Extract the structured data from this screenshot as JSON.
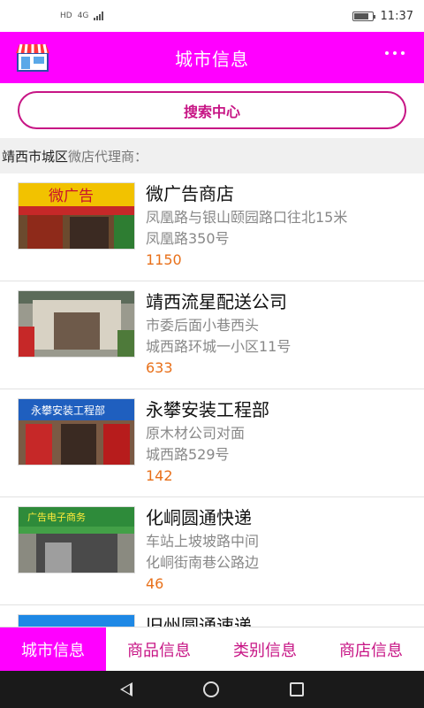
{
  "status_bar": {
    "hd_label": "HD",
    "network_label": "4G",
    "time": "11:37"
  },
  "header": {
    "title": "城市信息",
    "logo_icon": "shop-icon",
    "menu_icon": "more-icon"
  },
  "search": {
    "label": "搜索中心"
  },
  "section": {
    "city": "靖西市城区",
    "suffix": "微店代理商："
  },
  "stores": [
    {
      "name": "微广告商店",
      "line1": "凤凰路与银山颐园路口往北15米",
      "line2": "凤凰路350号",
      "count": "1150",
      "sign_text": "微广告"
    },
    {
      "name": "靖西流星配送公司",
      "line1": "市委后面小巷西头",
      "line2": "城西路环城一小区11号",
      "count": "633",
      "sign_text": ""
    },
    {
      "name": "永攀安装工程部",
      "line1": "原木材公司对面",
      "line2": "城西路529号",
      "count": "142",
      "sign_text": "永攀安装工程部"
    },
    {
      "name": "化峒圆通快递",
      "line1": "车站上坡坡路中间",
      "line2": "化峒街南巷公路边",
      "count": "46",
      "sign_text": "广告电子商务"
    },
    {
      "name": "旧州圆通速递",
      "line1": "",
      "line2": "",
      "count": "",
      "sign_text": ""
    }
  ],
  "tabs": [
    {
      "label": "城市信息",
      "active": true
    },
    {
      "label": "商品信息",
      "active": false
    },
    {
      "label": "类别信息",
      "active": false
    },
    {
      "label": "商店信息",
      "active": false
    }
  ],
  "colors": {
    "brand": "#ff00ff",
    "accent": "#c71585",
    "count": "#e8701a"
  }
}
